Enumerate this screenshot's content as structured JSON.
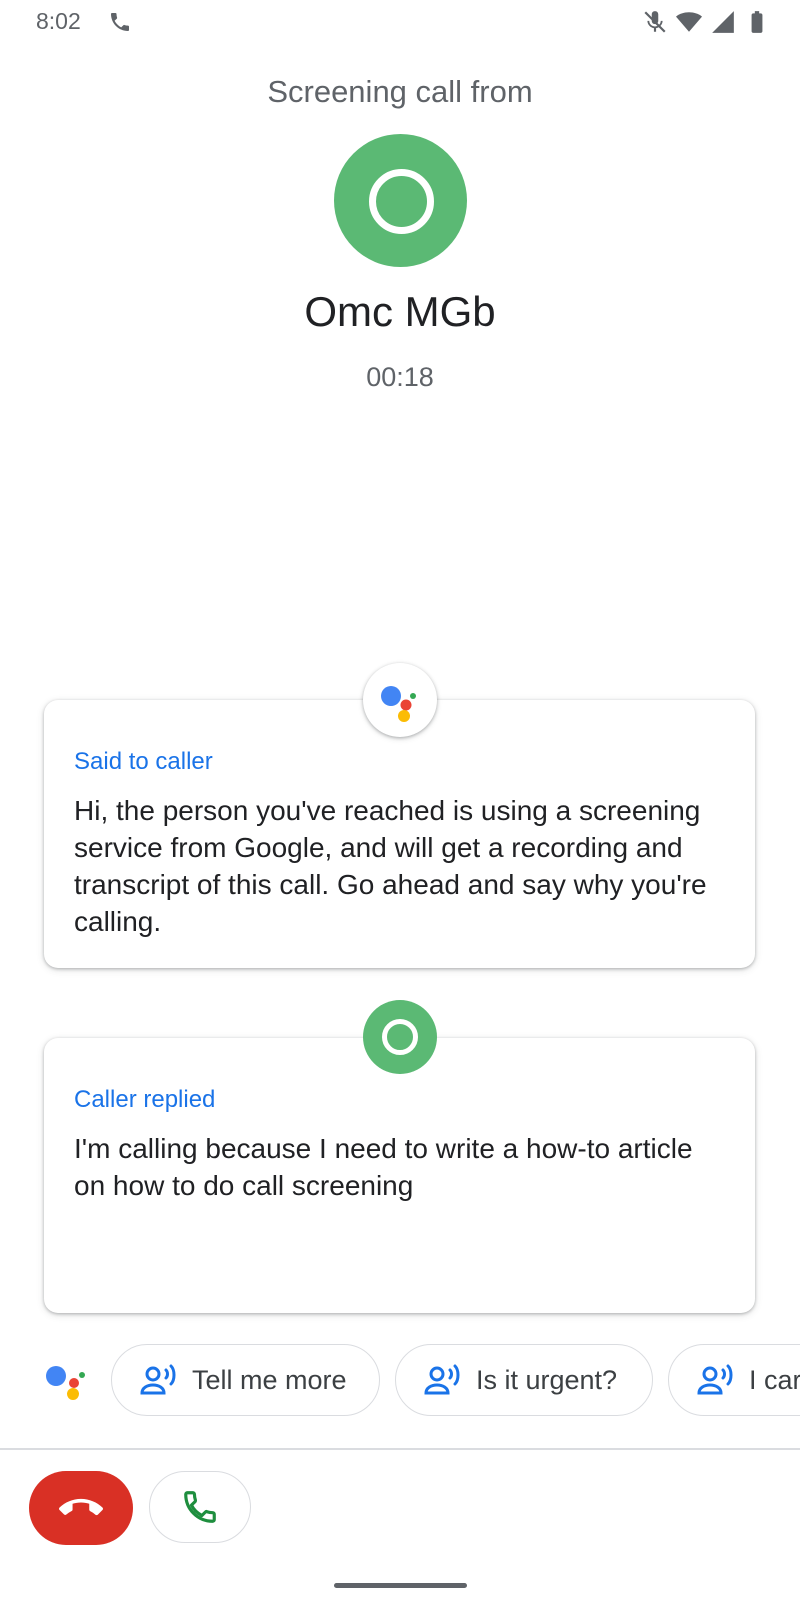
{
  "status_bar": {
    "time": "8:02",
    "icons": [
      "phone-call-icon",
      "mic-muted-icon",
      "wifi-icon",
      "cell-signal-icon",
      "battery-icon"
    ]
  },
  "header": {
    "screening_label": "Screening call from",
    "caller_name": "Omc MGb",
    "timer": "00:18",
    "avatar_color": "#5bb974"
  },
  "transcript": [
    {
      "speaker_icon": "google-assistant-icon",
      "title": "Said to caller",
      "text": "Hi, the person you've reached is using a screening service from Google, and will get a recording and transcript of this call. Go ahead and say why you're calling."
    },
    {
      "speaker_icon": "caller-avatar-icon",
      "title": "Caller replied",
      "text": "I'm calling because I need to write a how-to article on how to do call screening"
    }
  ],
  "suggestions": {
    "logo_icon": "google-assistant-icon",
    "chips": [
      {
        "icon": "speak-person-icon",
        "label": "Tell me more"
      },
      {
        "icon": "speak-person-icon",
        "label": "Is it urgent?"
      },
      {
        "icon": "speak-person-icon",
        "label": "I car"
      }
    ]
  },
  "controls": {
    "hangup_icon": "call-end-icon",
    "answer_icon": "phone-answer-icon",
    "hangup_color": "#d93025",
    "answer_color": "#1e8e3e"
  },
  "colors": {
    "accent": "#1a73e8",
    "caller_green": "#5bb974",
    "hangup_red": "#d93025"
  }
}
